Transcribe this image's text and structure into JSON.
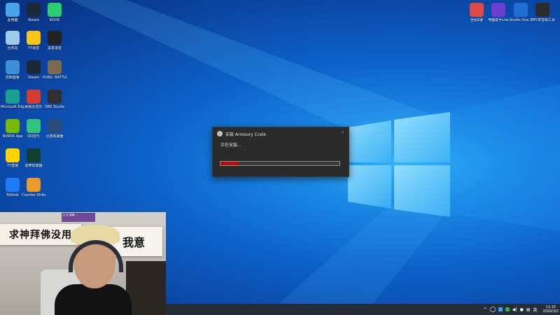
{
  "desktop_icons": [
    {
      "label": "此电脑",
      "color": "#4aa3e8",
      "icon": "computer-icon"
    },
    {
      "label": "Steam",
      "color": "#1b2838",
      "icon": "steam-icon"
    },
    {
      "label": "KOOK",
      "color": "#2ecc71",
      "icon": "kook-icon"
    },
    {
      "label": "回收站",
      "color": "#9ec9ea",
      "icon": "recycle-bin-icon"
    },
    {
      "label": "YY语音",
      "color": "#f5c518",
      "icon": "yy-icon"
    },
    {
      "label": "黑盒语音",
      "color": "#222222",
      "icon": "heybox-icon"
    },
    {
      "label": "控制面板",
      "color": "#3b8fd4",
      "icon": "control-panel-icon"
    },
    {
      "label": "Steam",
      "color": "#1b2838",
      "icon": "steam-icon"
    },
    {
      "label": "PUBG: BATTLEGR...",
      "color": "#7b6a4e",
      "icon": "pubg-icon"
    },
    {
      "label": "Microsoft Edge",
      "color": "#1a9e8f",
      "icon": "edge-icon"
    },
    {
      "label": "网易云音乐",
      "color": "#d33a31",
      "icon": "netease-music-icon"
    },
    {
      "label": "OBS Studio",
      "color": "#302e31",
      "icon": "obs-icon"
    },
    {
      "label": "NVIDIA App",
      "color": "#76b900",
      "icon": "nvidia-icon"
    },
    {
      "label": "QQ音乐",
      "color": "#31c27c",
      "icon": "qq-music-icon"
    },
    {
      "label": "迅游加速器",
      "color": "#2a4b7a",
      "icon": "speedometer-icon"
    },
    {
      "label": "YY直播",
      "color": "#ffd400",
      "icon": "yy-live-icon"
    },
    {
      "label": "雷神加速器",
      "color": "#0f3f2e",
      "icon": "triangle-icon"
    },
    {
      "label": "ToDesk",
      "color": "#1d7bf5",
      "icon": "todesk-icon"
    },
    {
      "label": "Counter-Strike 2",
      "color": "#e79a2b",
      "icon": "cs2-icon"
    }
  ],
  "top_right_icons": [
    {
      "label": "全民K歌",
      "color": "#e04848",
      "icon": "karaoke-icon"
    },
    {
      "label": "电脑助手Lite",
      "color": "#6a3fd1",
      "icon": "assistant-icon"
    },
    {
      "label": "Studio One 7",
      "color": "#1f6fd6",
      "icon": "studio-one-icon"
    },
    {
      "label": "四叶草音频工具箱",
      "color": "#2c2c2c",
      "icon": "audio-tool-icon"
    }
  ],
  "dialog": {
    "title": "安装 Armoury Crate",
    "status": "正在安装...",
    "close": "×",
    "progress_fraction": 0.15
  },
  "webcam": {
    "banner_left": "求神拜佛没用",
    "banner_right": "我意",
    "overlay_text": "正 在 直播 ..."
  },
  "taskbar": {
    "ime": "英",
    "time": "11:15",
    "date": "2026/3/2"
  }
}
